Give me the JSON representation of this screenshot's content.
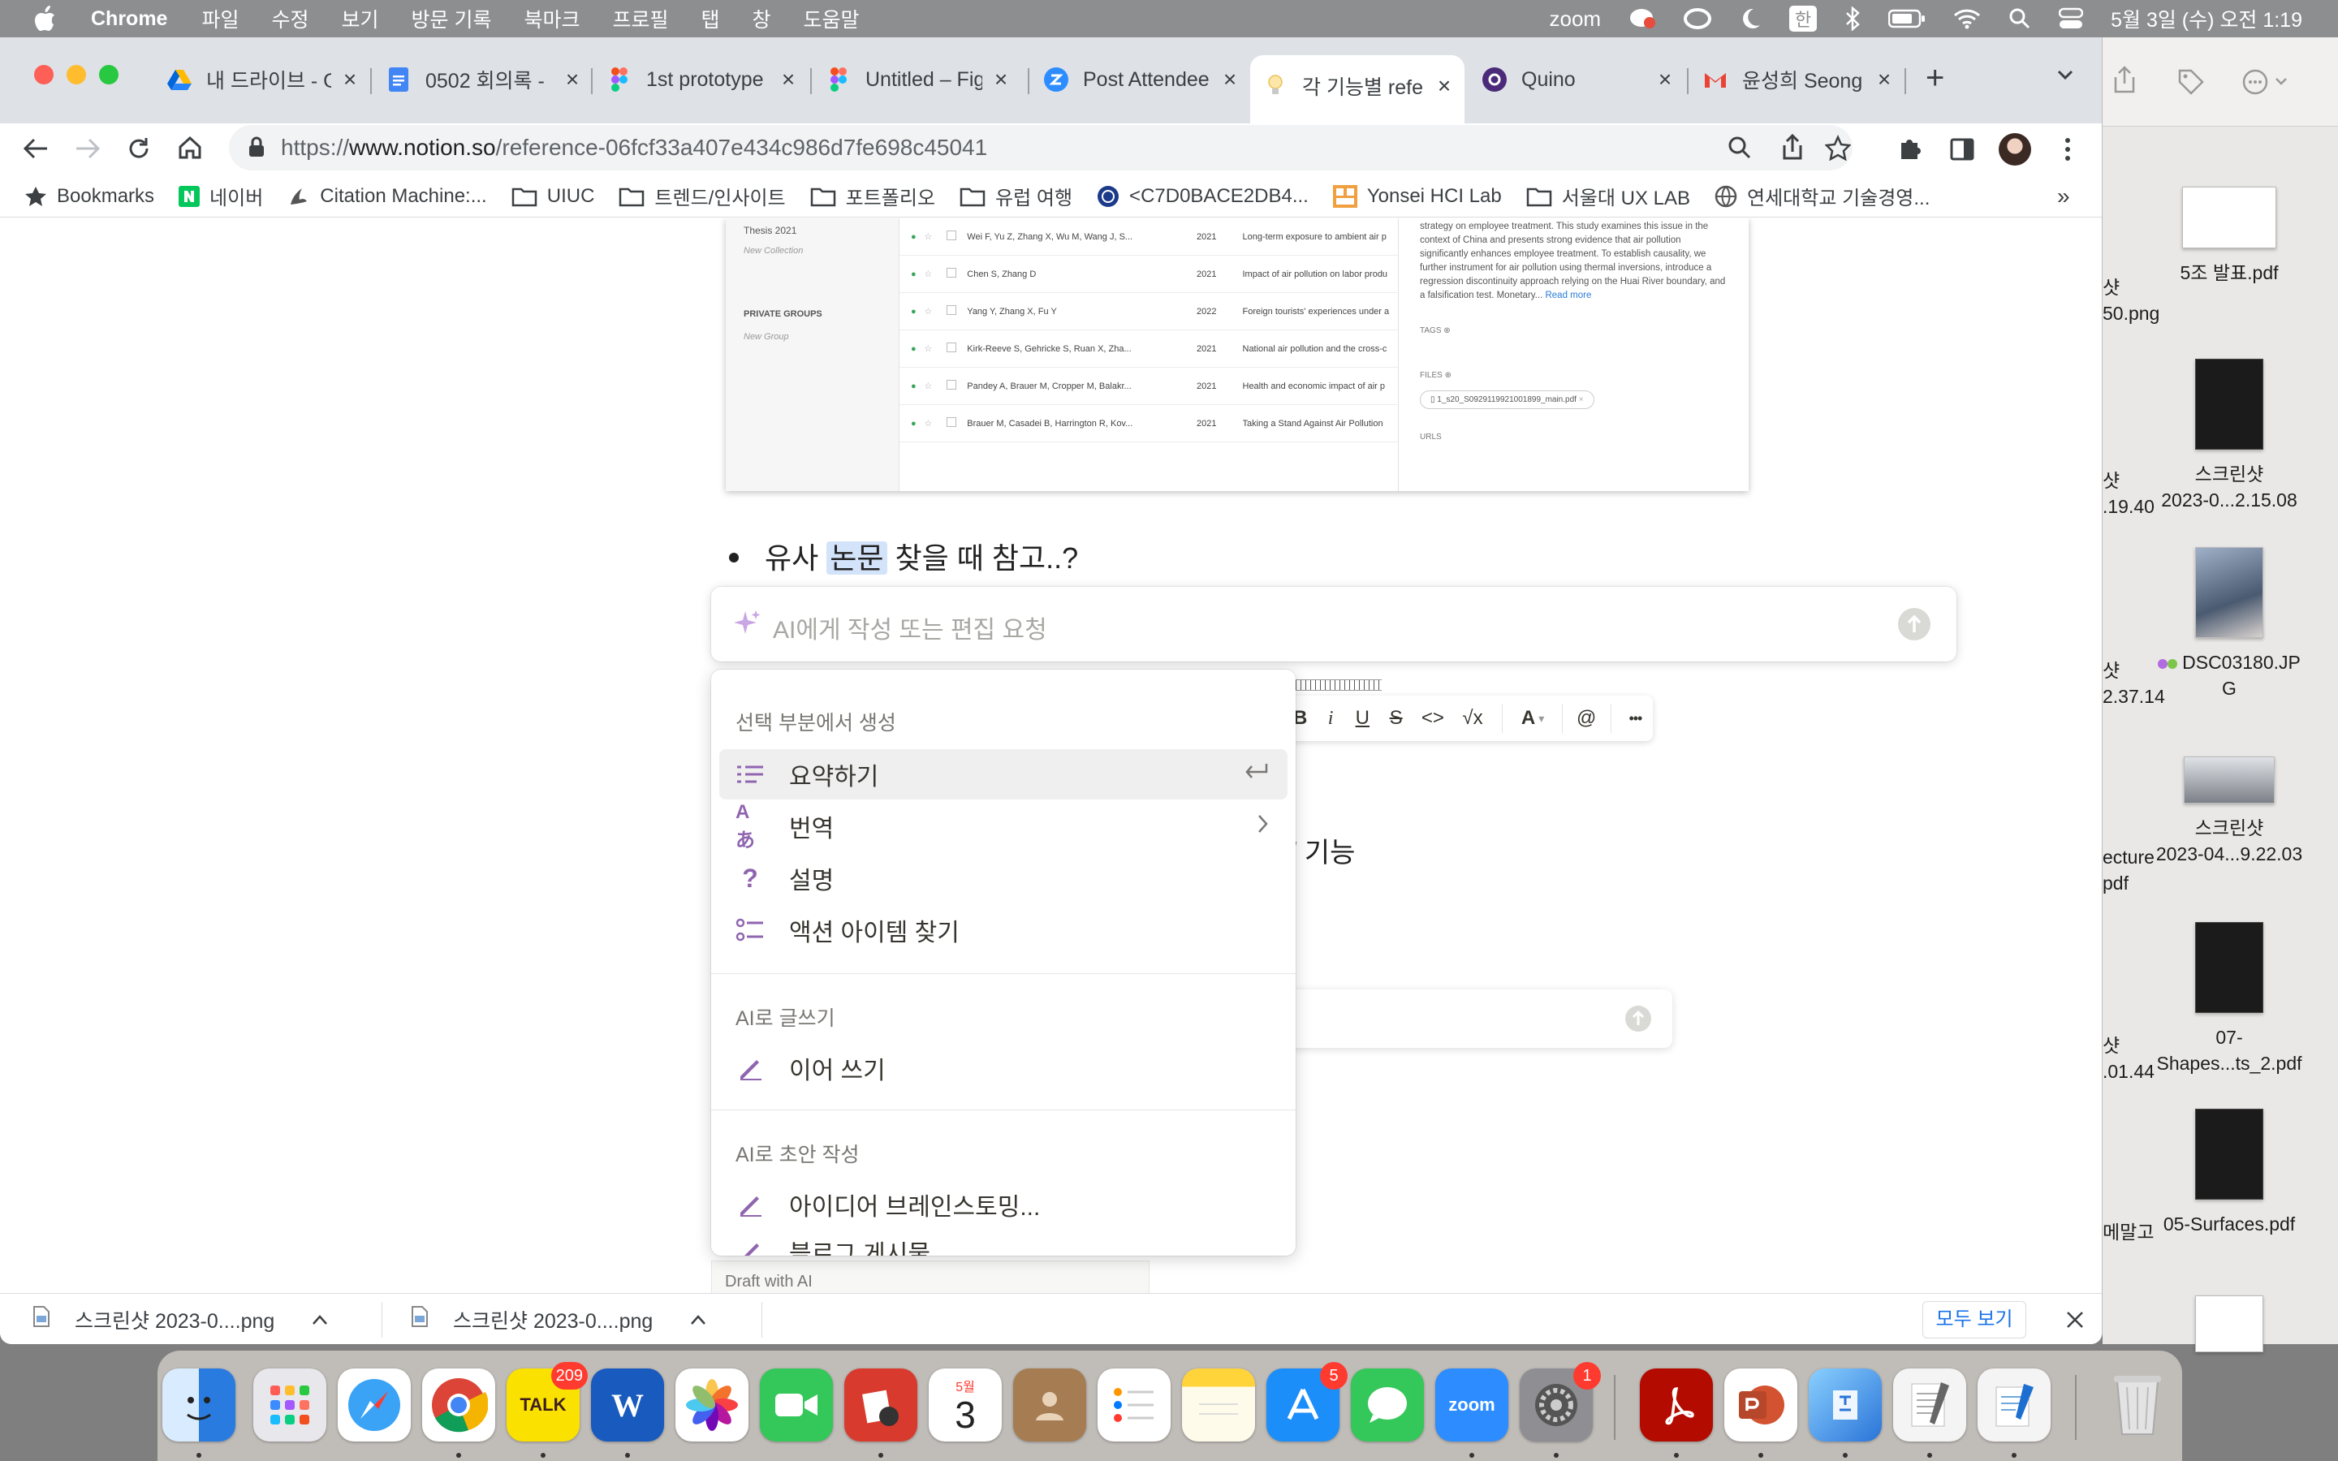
{
  "menubar": {
    "app_name": "Chrome",
    "menus": [
      "파일",
      "수정",
      "보기",
      "방문 기록",
      "북마크",
      "프로필",
      "탭",
      "창",
      "도움말"
    ],
    "zoom_label": "zoom",
    "input_source": "한",
    "datetime": "5월 3일 (수) 오전 1:19"
  },
  "tabs": [
    {
      "title": "내 드라이브 - G",
      "icon": "google-drive-icon"
    },
    {
      "title": "0502 회의록 - ",
      "icon": "google-docs-icon"
    },
    {
      "title": "1st prototype",
      "icon": "figma-icon"
    },
    {
      "title": "Untitled – Fig",
      "icon": "figma-icon"
    },
    {
      "title": "Post Attendee",
      "icon": "zoom-icon"
    },
    {
      "title": "각 기능별 refe",
      "icon": "notion-bulb-icon",
      "active": true
    },
    {
      "title": "Quino",
      "icon": "quino-icon"
    },
    {
      "title": "윤성희 Seong",
      "icon": "gmail-icon"
    }
  ],
  "address": {
    "protocol": "https://",
    "domain": "www.notion.so",
    "path": "/reference-06fcf33a407e434c986d7fe698c45041"
  },
  "bookmarks": [
    {
      "label": "Bookmarks",
      "icon": "star-icon"
    },
    {
      "label": "네이버",
      "icon": "naver-icon"
    },
    {
      "label": "Citation Machine:...",
      "icon": "citation-icon"
    },
    {
      "label": "UIUC",
      "icon": "folder-icon"
    },
    {
      "label": "트렌드/인사이트",
      "icon": "folder-icon"
    },
    {
      "label": "포트폴리오",
      "icon": "folder-icon"
    },
    {
      "label": "유럽 여행",
      "icon": "folder-icon"
    },
    {
      "label": "<C7D0BACE2DB4...",
      "icon": "yonsei-icon"
    },
    {
      "label": "Yonsei HCI Lab",
      "icon": "hci-icon"
    },
    {
      "label": "서울대 UX LAB",
      "icon": "folder-icon"
    },
    {
      "label": "연세대학교 기술경영...",
      "icon": "globe-icon"
    }
  ],
  "embed": {
    "sidebar": {
      "item1": "Thesis 2021",
      "item2": "New Collection",
      "group_header": "PRIVATE GROUPS",
      "item3": "New Group"
    },
    "rows": [
      {
        "authors": "Wei F, Yu Z, Zhang X, Wu M, Wang J, S...",
        "year": "2021",
        "title": "Long-term exposure to ambient air p"
      },
      {
        "authors": "Chen S, Zhang D",
        "year": "2021",
        "title": "Impact of air pollution on labor produ"
      },
      {
        "authors": "Yang Y, Zhang X, Fu Y",
        "year": "2022",
        "title": "Foreign tourists' experiences under a"
      },
      {
        "authors": "Kirk-Reeve S, Gehricke S, Ruan X, Zha...",
        "year": "2021",
        "title": "National air pollution and the cross-c"
      },
      {
        "authors": "Pandey A, Brauer M, Cropper M, Balakr...",
        "year": "2021",
        "title": "Health and economic impact of air p"
      },
      {
        "authors": "Brauer M, Casadei B, Harrington R, Kov...",
        "year": "2021",
        "title": "Taking a Stand Against Air Pollution"
      }
    ],
    "abstract": "strategy on employee treatment. This study examines this issue in the context of China and presents strong evidence that air pollution significantly enhances employee treatment. To establish causality, we further instrument for air pollution using thermal inversions, introduce a regression discontinuity approach relying on the Huai River boundary, and a falsification test. Monetary...",
    "read_more": "Read more",
    "tags_label": "TAGS",
    "files_label": "FILES",
    "file_name": "1_s20_S0929119921001899_main.pdf",
    "urls_label": "URLS"
  },
  "page": {
    "bullet_before": "유사 ",
    "bullet_highlight": "논문",
    "bullet_after": " 찾을 때 참고..?",
    "bg_text": "기능",
    "draft_label": "Draft with AI"
  },
  "ai_input": {
    "placeholder": "AI에게 작성 또는 편집 요청"
  },
  "format_bar": {
    "bold": "B",
    "italic": "i",
    "underline": "U",
    "strike": "S",
    "code": "<>",
    "math": "√x",
    "color": "A",
    "mention": "@",
    "more": "•••"
  },
  "ai_menu": {
    "section1": "선택 부분에서 생성",
    "summarize": "요약하기",
    "translate": "번역",
    "explain": "설명",
    "action_items": "액션 아이템 찾기",
    "section2": "AI로 글쓰기",
    "continue": "이어 쓰기",
    "section3": "AI로 초안 작성",
    "brainstorm": "아이디어 브레인스토밍...",
    "blog": "블로그 게시물"
  },
  "downloads": {
    "file1": "스크린샷 2023-0....png",
    "file2": "스크린샷 2023-0....png",
    "show_all": "모두 보기"
  },
  "desktop": {
    "items": [
      {
        "label1": "5조 발표.pdf",
        "label2": ""
      },
      {
        "label1": "스크린샷",
        "label2": "2023-0...2.15.08"
      },
      {
        "label1": "DSC03180.JP",
        "label2": "G"
      },
      {
        "label1": "스크린샷",
        "label2": "2023-04...9.22.03"
      },
      {
        "label1": "07-",
        "label2": "Shapes...ts_2.pdf"
      },
      {
        "label1": "05-Surfaces.pdf",
        "label2": ""
      }
    ],
    "cut": [
      "샷",
      "50.png",
      "샷",
      ".19.40",
      "샷",
      "2.37.14",
      "ecture",
      "pdf",
      "샷",
      ".01.44",
      "메말고"
    ]
  },
  "dock": {
    "kakao_badge": "209",
    "calendar_month": "5월",
    "calendar_day": "3",
    "appstore_badge": "5",
    "settings_badge": "1",
    "kakao_label": "TALK",
    "word_label": "W",
    "zoom_label": "zoom"
  },
  "colors": {
    "accent": "#1a73e8",
    "notion_purple": "#9065b0",
    "menu_bar": "#8d8e90"
  }
}
